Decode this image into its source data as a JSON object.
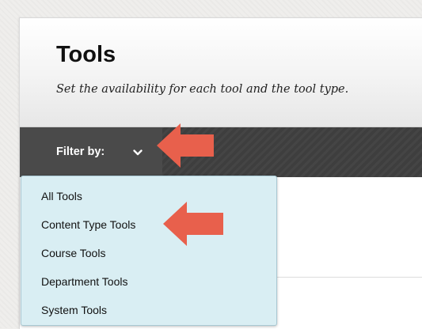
{
  "header": {
    "title": "Tools",
    "subtitle": "Set the availability for each tool and the tool type."
  },
  "toolbar": {
    "filter_label": "Filter by:",
    "filter_icon": "chevron-down-icon"
  },
  "filter_menu": {
    "items": [
      {
        "label": "All Tools"
      },
      {
        "label": "Content Type Tools"
      },
      {
        "label": "Course Tools"
      },
      {
        "label": "Department Tools"
      },
      {
        "label": "System Tools"
      }
    ]
  },
  "annotations": {
    "arrow_icon": "left-arrow-icon",
    "arrow_color": "#e8604c"
  },
  "colors": {
    "toolbar_bg": "#3e3e3e",
    "menu_bg": "#d9eef3"
  }
}
